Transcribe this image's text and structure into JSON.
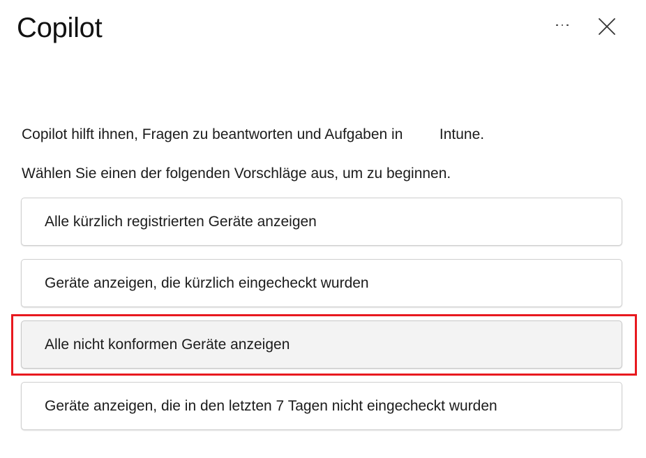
{
  "header": {
    "title": "Copilot",
    "more_icon": "more-horizontal-icon",
    "close_icon": "close-icon"
  },
  "intro": {
    "line1": "Copilot hilft ihnen, Fragen zu beantworten und Aufgaben in         Intune.",
    "line2": "Wählen Sie einen der folgenden Vorschläge aus, um zu beginnen."
  },
  "suggestions": [
    {
      "label": "Alle kürzlich registrierten Geräte anzeigen"
    },
    {
      "label": "Geräte anzeigen, die kürzlich eingecheckt wurden"
    },
    {
      "label": "Alle nicht konformen Geräte anzeigen"
    },
    {
      "label": "Geräte anzeigen, die in den letzten 7 Tagen nicht eingecheckt wurden"
    }
  ],
  "colors": {
    "highlight": "#e8191f",
    "card_border": "#cfcfcf",
    "card_hover_bg": "#f3f3f3",
    "text": "#1b1b1b"
  }
}
